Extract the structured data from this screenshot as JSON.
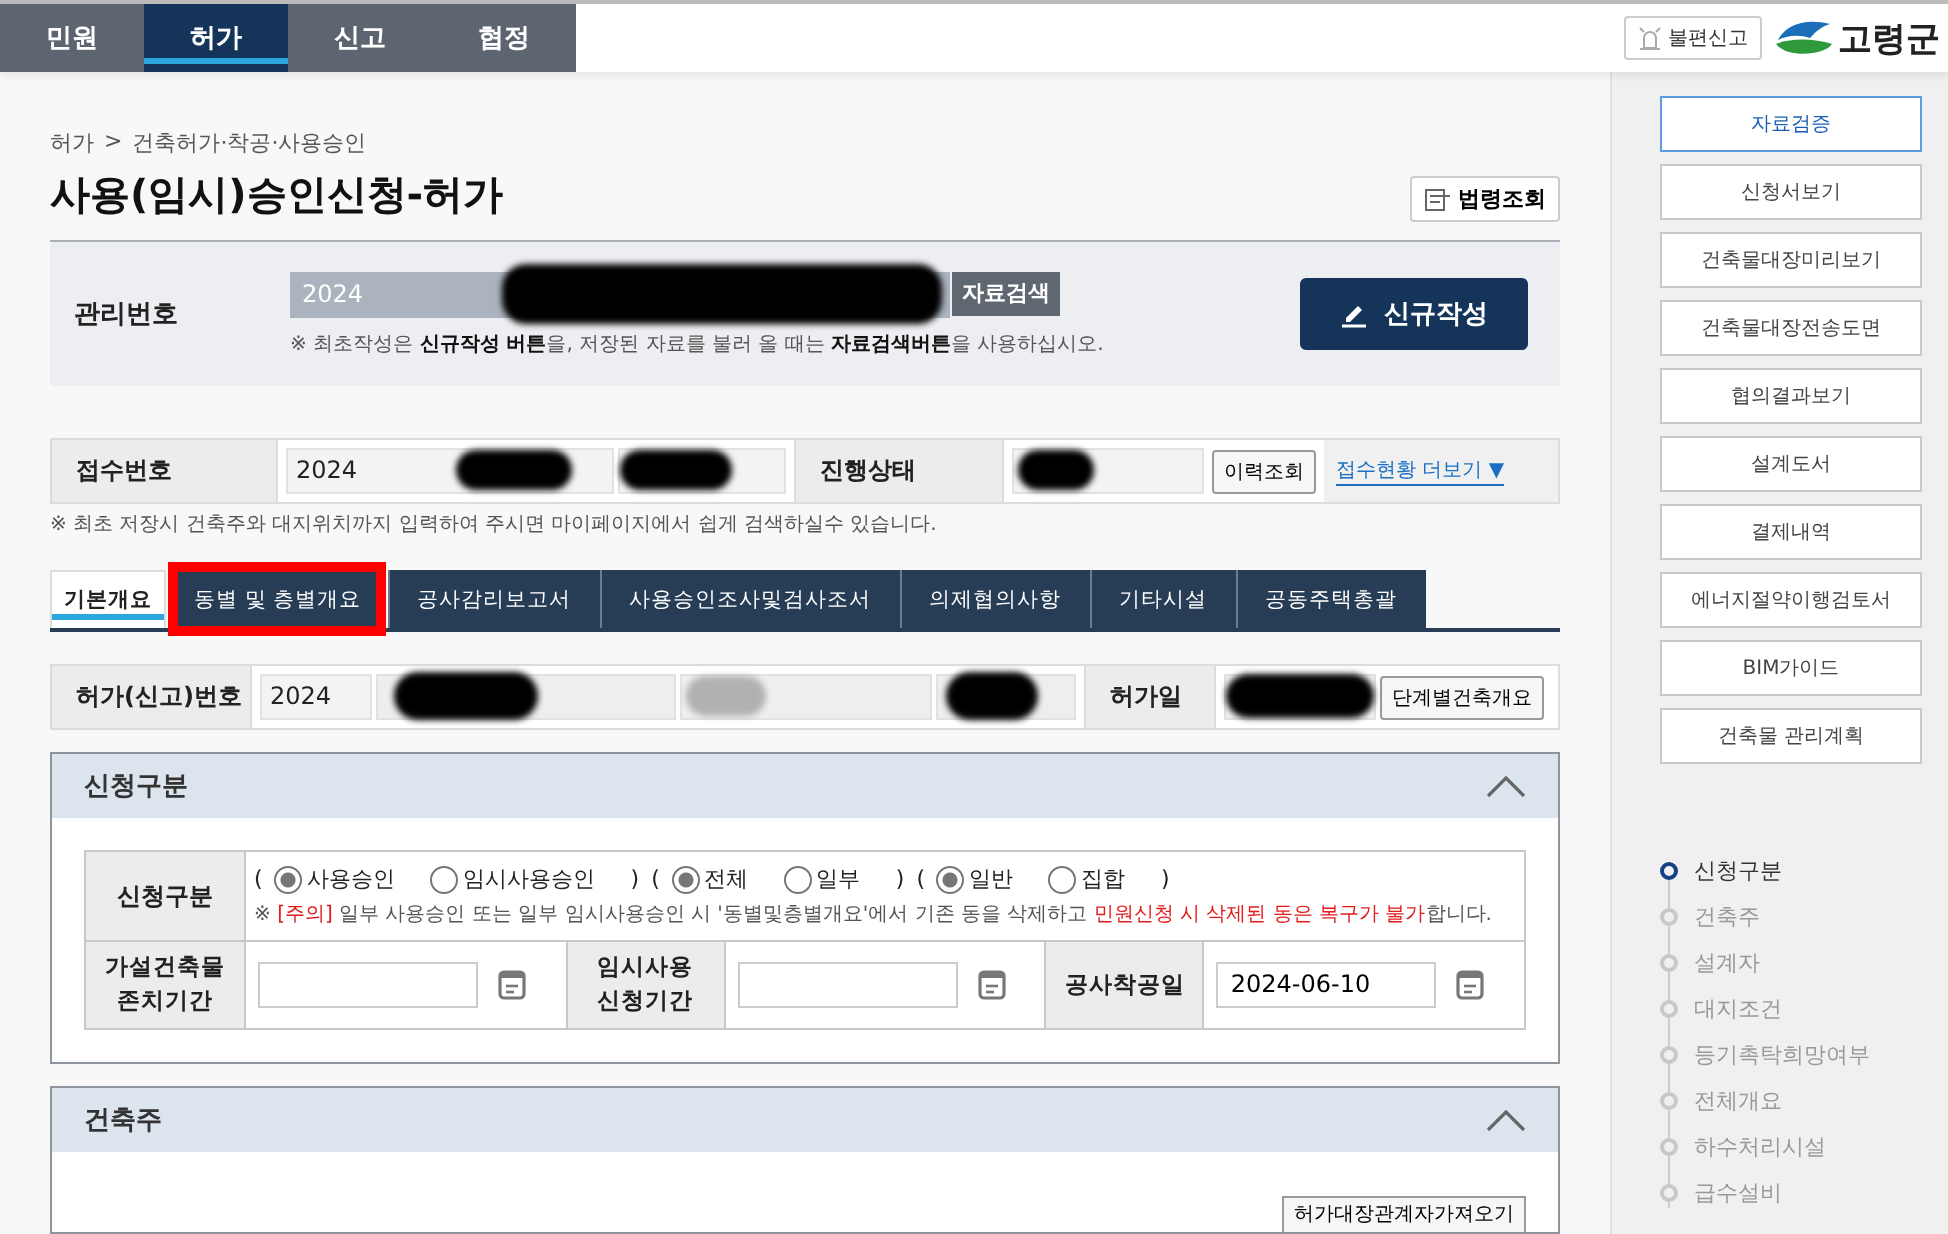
{
  "top_nav": {
    "tabs": [
      {
        "label": "민원",
        "selected": false
      },
      {
        "label": "허가",
        "selected": true
      },
      {
        "label": "신고",
        "selected": false
      },
      {
        "label": "협정",
        "selected": false
      }
    ],
    "report_button": "불편신고",
    "logo_text": "고령군"
  },
  "breadcrumb": {
    "items": [
      "허가",
      "건축허가·착공·사용승인"
    ],
    "separator": ">"
  },
  "page_title": "사용(임시)승인신청-허가",
  "law_button": "법령조회",
  "management": {
    "label": "관리번호",
    "value": "2024",
    "redacted": true,
    "search_button": "자료검색",
    "hint": "※ 최초작성은 **신규작성 버튼**을, 저장된 자료를 불러 올 때는 **자료검색버튼**을 사용하십시오.",
    "new_button": "신규작성"
  },
  "receipt": {
    "label": "접수번호",
    "boxes": [
      {
        "value": "2024",
        "redacted": true
      },
      {
        "redacted": true
      }
    ],
    "status_label": "진행상태",
    "status_redacted": true,
    "history_button": "이력조회",
    "more_link": "접수현황 더보기 ▼"
  },
  "receipt_note": "※ 최초 저장시 건축주와 대지위치까지 입력하여 주시면 마이페이지에서 쉽게 검색하실수 있습니다.",
  "tabs": [
    {
      "label": "기본개요",
      "selected": true,
      "highlighted": false
    },
    {
      "label": "동별 및 층별개요",
      "selected": false,
      "highlighted": true
    },
    {
      "label": "공사감리보고서",
      "selected": false,
      "highlighted": false
    },
    {
      "label": "사용승인조사및검사조서",
      "selected": false,
      "highlighted": false
    },
    {
      "label": "의제협의사항",
      "selected": false,
      "highlighted": false
    },
    {
      "label": "기타시설",
      "selected": false,
      "highlighted": false
    },
    {
      "label": "공동주택총괄",
      "selected": false,
      "highlighted": false
    }
  ],
  "permit": {
    "label": "허가(신고)번호",
    "boxes": [
      {
        "value": "2024"
      },
      {
        "redacted": true
      },
      {
        "redacted": true
      },
      {
        "redacted": true
      }
    ],
    "date_label": "허가일",
    "date_redacted": true,
    "stage_button": "단계별건축개요"
  },
  "application_section": {
    "title": "신청구분",
    "expanded": true,
    "label": "신청구분",
    "groups": [
      {
        "open": "(",
        "options": [
          {
            "label": "사용승인",
            "selected": true
          },
          {
            "label": "임시사용승인",
            "selected": false
          }
        ],
        "close": ")"
      },
      {
        "open": "(",
        "options": [
          {
            "label": "전체",
            "selected": true
          },
          {
            "label": "일부",
            "selected": false
          }
        ],
        "close": ")"
      },
      {
        "open": "(",
        "options": [
          {
            "label": "일반",
            "selected": true
          },
          {
            "label": "집합",
            "selected": false
          }
        ],
        "close": ")"
      }
    ],
    "warning": "※ **[주의]** 일부 사용승인 또는 일부 임시사용승인 시 '동별및층별개요'에서 기존 동을 삭제하고 **민원신청 시 삭제된 동은 복구가 불가**합니다.",
    "fields": [
      {
        "label": "가설건축물 존치기간"
      },
      {
        "label": "임시사용 신청기간"
      },
      {
        "label": "공사착공일",
        "value": "2024-06-10"
      }
    ]
  },
  "owner_section": {
    "title": "건축주",
    "expanded": true,
    "import_button": "허가대장관계자가져오기"
  },
  "sidebar": {
    "buttons": [
      {
        "label": "자료검증",
        "selected": true
      },
      {
        "label": "신청서보기",
        "selected": false
      },
      {
        "label": "건축물대장미리보기",
        "selected": false
      },
      {
        "label": "건축물대장전송도면",
        "selected": false
      },
      {
        "label": "협의결과보기",
        "selected": false
      },
      {
        "label": "설계도서",
        "selected": false
      },
      {
        "label": "결제내역",
        "selected": false
      },
      {
        "label": "에너지절약이행검토서",
        "selected": false
      },
      {
        "label": "BIM가이드",
        "selected": false
      },
      {
        "label": "건축물 관리계획",
        "selected": false
      }
    ],
    "steps": [
      {
        "label": "신청구분",
        "selected": true
      },
      {
        "label": "건축주",
        "selected": false
      },
      {
        "label": "설계자",
        "selected": false
      },
      {
        "label": "대지조건",
        "selected": false
      },
      {
        "label": "등기촉탁희망여부",
        "selected": false
      },
      {
        "label": "전체개요",
        "selected": false
      },
      {
        "label": "하수처리시설",
        "selected": false
      },
      {
        "label": "급수설비",
        "selected": false
      }
    ]
  }
}
